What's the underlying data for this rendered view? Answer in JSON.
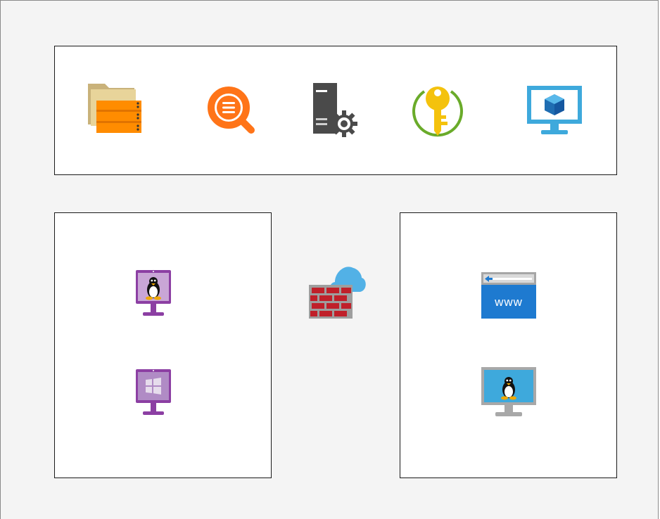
{
  "diagram": {
    "top_group": {
      "icons": [
        {
          "name": "storage-files-icon"
        },
        {
          "name": "log-analytics-icon"
        },
        {
          "name": "server-settings-icon"
        },
        {
          "name": "key-vault-icon"
        },
        {
          "name": "virtual-machine-icon"
        }
      ]
    },
    "left_group": {
      "icons": [
        {
          "name": "linux-vm-purple-icon"
        },
        {
          "name": "windows-vm-purple-icon"
        }
      ]
    },
    "center": {
      "icons": [
        {
          "name": "cloud-firewall-icon"
        }
      ]
    },
    "right_group": {
      "icons": [
        {
          "name": "web-app-icon",
          "text": "www"
        },
        {
          "name": "linux-vm-blue-icon"
        }
      ]
    },
    "colors": {
      "background": "#f4f4f4",
      "box_fill": "#ffffff",
      "box_border": "#1a1a1a",
      "orange": "#ff8c00",
      "purple": "#8c3fa3",
      "azure_blue": "#1e7ad0",
      "firewall_red": "#c0202a",
      "key_yellow": "#f4c20d",
      "key_green": "#6aab2a"
    }
  }
}
